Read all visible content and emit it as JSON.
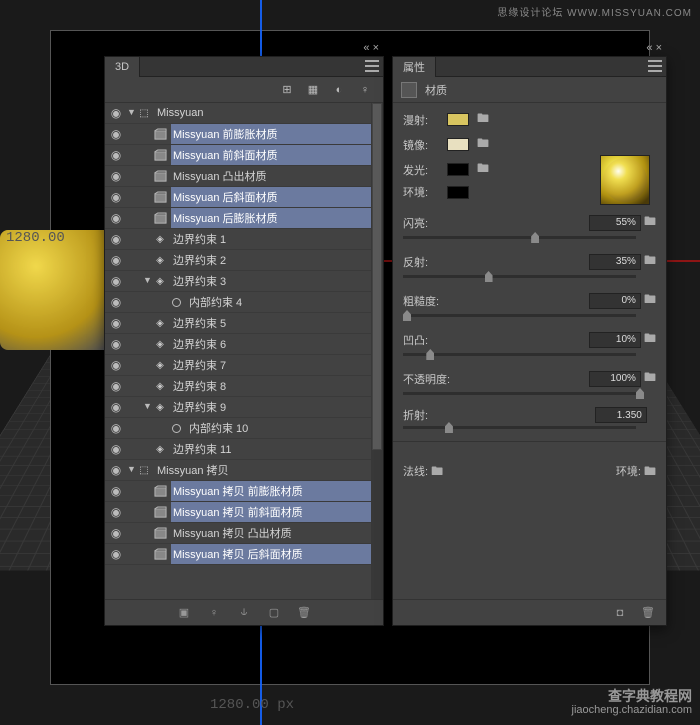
{
  "watermark_top": "思缘设计论坛  WWW.MISSYUAN.COM",
  "watermark_bot_title": "查字典教程网",
  "watermark_bot_url": "jiaocheng.chazidian.com",
  "coord_top": "1280.00",
  "coord_bot": "1280.00 px",
  "panel3d": {
    "title": "3D",
    "tree": [
      {
        "d": 0,
        "ico": "mesh",
        "arrow": "▼",
        "label": "Missyuan",
        "sel": false
      },
      {
        "d": 1,
        "ico": "mat",
        "label": "Missyuan 前膨胀材质",
        "sel": true
      },
      {
        "d": 1,
        "ico": "mat",
        "label": "Missyuan 前斜面材质",
        "sel": true
      },
      {
        "d": 1,
        "ico": "mat",
        "label": "Missyuan 凸出材质",
        "sel": false
      },
      {
        "d": 1,
        "ico": "mat",
        "label": "Missyuan 后斜面材质",
        "sel": true
      },
      {
        "d": 1,
        "ico": "mat",
        "label": "Missyuan 后膨胀材质",
        "sel": true
      },
      {
        "d": 1,
        "ico": "light",
        "label": "边界约束 1",
        "sel": false
      },
      {
        "d": 1,
        "ico": "light",
        "label": "边界约束 2",
        "sel": false
      },
      {
        "d": 1,
        "ico": "light",
        "arrow": "▼",
        "label": "边界约束 3",
        "sel": false
      },
      {
        "d": 2,
        "ico": "circle",
        "label": "内部约束 4",
        "sel": false
      },
      {
        "d": 1,
        "ico": "light",
        "label": "边界约束 5",
        "sel": false
      },
      {
        "d": 1,
        "ico": "light",
        "label": "边界约束 6",
        "sel": false
      },
      {
        "d": 1,
        "ico": "light",
        "label": "边界约束 7",
        "sel": false
      },
      {
        "d": 1,
        "ico": "light",
        "label": "边界约束 8",
        "sel": false
      },
      {
        "d": 1,
        "ico": "light",
        "arrow": "▼",
        "label": "边界约束 9",
        "sel": false
      },
      {
        "d": 2,
        "ico": "circle",
        "label": "内部约束 10",
        "sel": false
      },
      {
        "d": 1,
        "ico": "light",
        "label": "边界约束 11",
        "sel": false
      },
      {
        "d": 0,
        "ico": "mesh",
        "arrow": "▼",
        "label": "Missyuan 拷贝",
        "sel": false
      },
      {
        "d": 1,
        "ico": "mat",
        "label": "Missyuan 拷贝 前膨胀材质",
        "sel": true
      },
      {
        "d": 1,
        "ico": "mat",
        "label": "Missyuan 拷贝 前斜面材质",
        "sel": true
      },
      {
        "d": 1,
        "ico": "mat",
        "label": "Missyuan 拷贝 凸出材质",
        "sel": false
      },
      {
        "d": 1,
        "ico": "mat",
        "label": "Missyuan 拷贝 后斜面材质",
        "sel": true
      }
    ]
  },
  "props": {
    "title": "属性",
    "subtitle": "材质",
    "rows": {
      "diffuse": "漫射:",
      "specular": "镜像:",
      "emissive": "发光:",
      "ambient": "环境:"
    },
    "colors": {
      "diffuse": "#d8c560",
      "specular": "#e8e0c0",
      "emissive": "#000000",
      "ambient": "#000000"
    },
    "sliders": [
      {
        "label": "闪亮:",
        "value": "55%",
        "pos": 55,
        "folder": true
      },
      {
        "label": "反射:",
        "value": "35%",
        "pos": 35,
        "folder": true
      },
      {
        "label": "粗糙度:",
        "value": "0%",
        "pos": 0,
        "folder": true
      },
      {
        "label": "凹凸:",
        "value": "10%",
        "pos": 10,
        "folder": true
      },
      {
        "label": "不透明度:",
        "value": "100%",
        "pos": 100,
        "folder": true
      },
      {
        "label": "折射:",
        "value": "1.350",
        "pos": 18,
        "folder": false
      }
    ],
    "normal_label": "法线:",
    "env_label": "环境:"
  }
}
